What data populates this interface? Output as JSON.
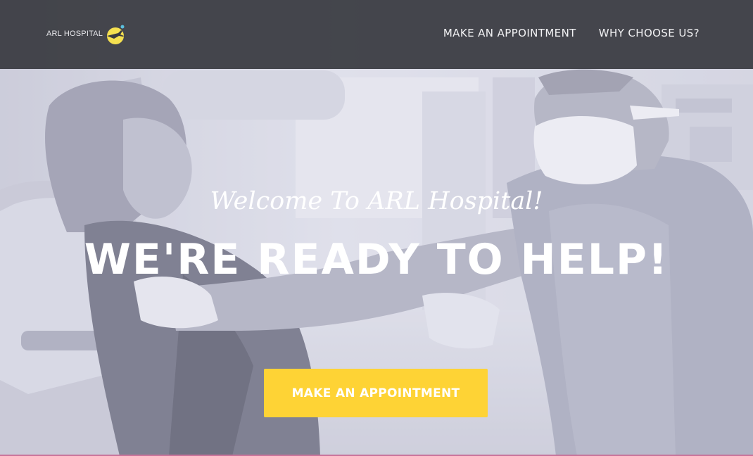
{
  "brand": {
    "logo_text": "ARL HOSPITAL",
    "logo_icon": "crescent-moon-plane-icon",
    "logo_color": "#f5e050"
  },
  "nav": {
    "items": [
      {
        "label": "MAKE AN APPOINTMENT"
      },
      {
        "label": "WHY CHOOSE US?"
      }
    ]
  },
  "hero": {
    "welcome": "Welcome To ARL Hospital!",
    "headline": "WE'RE READY TO HELP!",
    "cta_label": "MAKE AN APPOINTMENT",
    "cta_color": "#fed335",
    "image_subject": "doctor-with-patient-photo"
  }
}
